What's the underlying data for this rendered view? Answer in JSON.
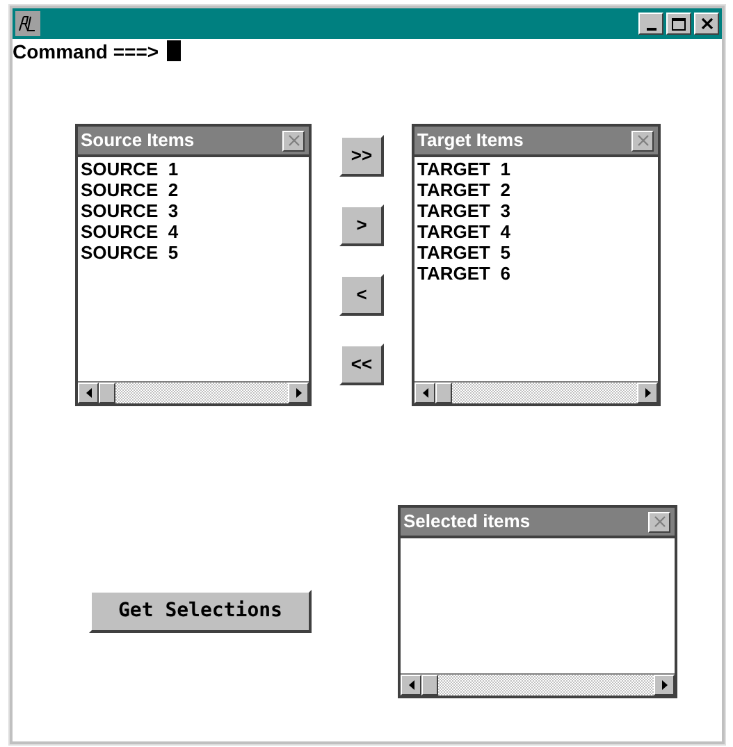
{
  "command_line": {
    "prompt": "Command ===>"
  },
  "source_panel": {
    "title": "Source Items",
    "items": [
      "SOURCE  1",
      "SOURCE  2",
      "SOURCE  3",
      "SOURCE  4",
      "SOURCE  5"
    ]
  },
  "move_buttons": [
    ">>",
    ">",
    "<",
    "<<"
  ],
  "target_panel": {
    "title": "Target Items",
    "items": [
      "TARGET  1",
      "TARGET  2",
      "TARGET  3",
      "TARGET  4",
      "TARGET  5",
      "TARGET  6"
    ]
  },
  "get_button": {
    "label": "Get Selections"
  },
  "selected_panel": {
    "title": "Selected items"
  }
}
